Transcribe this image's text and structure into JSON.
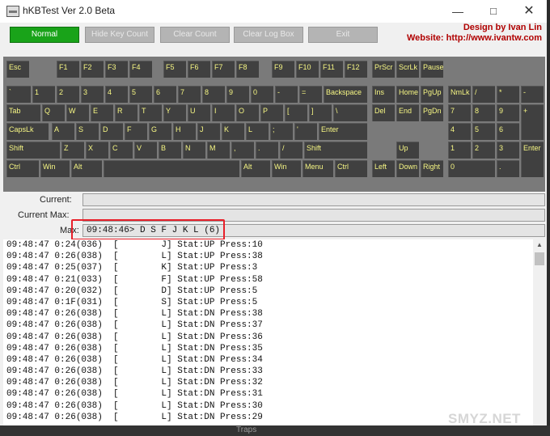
{
  "window": {
    "title": "hKBTest Ver 2.0 Beta"
  },
  "toolbar": {
    "normal": "Normal",
    "hide_key_count": "Hide Key Count",
    "clear_count": "Clear Count",
    "clear_log_box": "Clear Log Box",
    "exit": "Exit",
    "credit_name": "Design by Ivan Lin",
    "credit_site": "Website: http://www.ivantw.com"
  },
  "keyboard": {
    "accent_color": "#f7f784",
    "keys": [
      {
        "id": "esc",
        "label": "Esc"
      },
      {
        "id": "f1",
        "label": "F1"
      },
      {
        "id": "f2",
        "label": "F2"
      },
      {
        "id": "f3",
        "label": "F3"
      },
      {
        "id": "f4",
        "label": "F4"
      },
      {
        "id": "f5",
        "label": "F5"
      },
      {
        "id": "f6",
        "label": "F6"
      },
      {
        "id": "f7",
        "label": "F7"
      },
      {
        "id": "f8",
        "label": "F8"
      },
      {
        "id": "f9",
        "label": "F9"
      },
      {
        "id": "f10",
        "label": "F10"
      },
      {
        "id": "f11",
        "label": "F11"
      },
      {
        "id": "f12",
        "label": "F12"
      },
      {
        "id": "prtscr",
        "label": "PrScr"
      },
      {
        "id": "scrlk",
        "label": "ScrLk"
      },
      {
        "id": "pause",
        "label": "Pause"
      },
      {
        "id": "backtick",
        "label": "`"
      },
      {
        "id": "1",
        "label": "1"
      },
      {
        "id": "2",
        "label": "2"
      },
      {
        "id": "3",
        "label": "3"
      },
      {
        "id": "4",
        "label": "4"
      },
      {
        "id": "5",
        "label": "5"
      },
      {
        "id": "6",
        "label": "6"
      },
      {
        "id": "7",
        "label": "7"
      },
      {
        "id": "8",
        "label": "8"
      },
      {
        "id": "9",
        "label": "9"
      },
      {
        "id": "0",
        "label": "0"
      },
      {
        "id": "minus",
        "label": "-"
      },
      {
        "id": "equal",
        "label": "="
      },
      {
        "id": "backspace",
        "label": "Backspace"
      },
      {
        "id": "ins",
        "label": "Ins"
      },
      {
        "id": "home",
        "label": "Home"
      },
      {
        "id": "pgup",
        "label": "PgUp"
      },
      {
        "id": "numlk",
        "label": "NmLk"
      },
      {
        "id": "npdiv",
        "label": "/"
      },
      {
        "id": "npmul",
        "label": "*"
      },
      {
        "id": "npsub",
        "label": "-"
      },
      {
        "id": "tab",
        "label": "Tab"
      },
      {
        "id": "q",
        "label": "Q"
      },
      {
        "id": "w",
        "label": "W"
      },
      {
        "id": "e",
        "label": "E"
      },
      {
        "id": "r",
        "label": "R"
      },
      {
        "id": "t",
        "label": "T"
      },
      {
        "id": "y",
        "label": "Y"
      },
      {
        "id": "u",
        "label": "U"
      },
      {
        "id": "i",
        "label": "I"
      },
      {
        "id": "o",
        "label": "O"
      },
      {
        "id": "p",
        "label": "P"
      },
      {
        "id": "lbr",
        "label": "["
      },
      {
        "id": "rbr",
        "label": "]"
      },
      {
        "id": "bslash",
        "label": "\\"
      },
      {
        "id": "del",
        "label": "Del"
      },
      {
        "id": "end",
        "label": "End"
      },
      {
        "id": "pgdn",
        "label": "PgDn"
      },
      {
        "id": "np7",
        "label": "7"
      },
      {
        "id": "np8",
        "label": "8"
      },
      {
        "id": "np9",
        "label": "9"
      },
      {
        "id": "npadd",
        "label": "+"
      },
      {
        "id": "capslk",
        "label": "CapsLk"
      },
      {
        "id": "a",
        "label": "A"
      },
      {
        "id": "s",
        "label": "S"
      },
      {
        "id": "d",
        "label": "D"
      },
      {
        "id": "f",
        "label": "F"
      },
      {
        "id": "g",
        "label": "G"
      },
      {
        "id": "h",
        "label": "H"
      },
      {
        "id": "j",
        "label": "J"
      },
      {
        "id": "k",
        "label": "K"
      },
      {
        "id": "l",
        "label": "L"
      },
      {
        "id": "semi",
        "label": ";"
      },
      {
        "id": "quote",
        "label": "'"
      },
      {
        "id": "enter",
        "label": "Enter"
      },
      {
        "id": "np4",
        "label": "4"
      },
      {
        "id": "np5",
        "label": "5"
      },
      {
        "id": "np6",
        "label": "6"
      },
      {
        "id": "lshift",
        "label": "Shift"
      },
      {
        "id": "z",
        "label": "Z"
      },
      {
        "id": "x",
        "label": "X"
      },
      {
        "id": "c",
        "label": "C"
      },
      {
        "id": "v",
        "label": "V"
      },
      {
        "id": "b",
        "label": "B"
      },
      {
        "id": "n",
        "label": "N"
      },
      {
        "id": "m",
        "label": "M"
      },
      {
        "id": "comma",
        "label": ","
      },
      {
        "id": "dot",
        "label": "."
      },
      {
        "id": "slash",
        "label": "/"
      },
      {
        "id": "rshift",
        "label": "Shift"
      },
      {
        "id": "up",
        "label": "Up"
      },
      {
        "id": "np1",
        "label": "1"
      },
      {
        "id": "np2",
        "label": "2"
      },
      {
        "id": "np3",
        "label": "3"
      },
      {
        "id": "npenter",
        "label": "Enter"
      },
      {
        "id": "lctrl",
        "label": "Ctrl"
      },
      {
        "id": "lwin",
        "label": "Win"
      },
      {
        "id": "lalt",
        "label": "Alt"
      },
      {
        "id": "space",
        "label": ""
      },
      {
        "id": "ralt",
        "label": "Alt"
      },
      {
        "id": "rwin",
        "label": "Win"
      },
      {
        "id": "menu",
        "label": "Menu"
      },
      {
        "id": "rctrl",
        "label": "Ctrl"
      },
      {
        "id": "left",
        "label": "Left"
      },
      {
        "id": "down",
        "label": "Down"
      },
      {
        "id": "right",
        "label": "Right"
      },
      {
        "id": "np0",
        "label": "0"
      },
      {
        "id": "npdot",
        "label": "."
      }
    ]
  },
  "status": {
    "current_label": "Current:",
    "current_value": "",
    "current_max_label": "Current Max:",
    "current_max_value": "",
    "max_label": "Max:",
    "max_value": "09:48:46> D S F J K L (6)"
  },
  "log": [
    "09:48:47 0:24(036)  [        J] Stat:UP Press:10",
    "09:48:47 0:26(038)  [        L] Stat:UP Press:38",
    "09:48:47 0:25(037)  [        K] Stat:UP Press:3",
    "09:48:47 0:21(033)  [        F] Stat:UP Press:58",
    "09:48:47 0:20(032)  [        D] Stat:UP Press:5",
    "09:48:47 0:1F(031)  [        S] Stat:UP Press:5",
    "09:48:47 0:26(038)  [        L] Stat:DN Press:38",
    "09:48:47 0:26(038)  [        L] Stat:DN Press:37",
    "09:48:47 0:26(038)  [        L] Stat:DN Press:36",
    "09:48:47 0:26(038)  [        L] Stat:DN Press:35",
    "09:48:47 0:26(038)  [        L] Stat:DN Press:34",
    "09:48:47 0:26(038)  [        L] Stat:DN Press:33",
    "09:48:47 0:26(038)  [        L] Stat:DN Press:32",
    "09:48:47 0:26(038)  [        L] Stat:DN Press:31",
    "09:48:47 0:26(038)  [        L] Stat:DN Press:30",
    "09:48:47 0:26(038)  [        L] Stat:DN Press:29"
  ],
  "taskbar": {
    "item": "Traps"
  },
  "watermark": {
    "text": "SMYZ.NET"
  }
}
